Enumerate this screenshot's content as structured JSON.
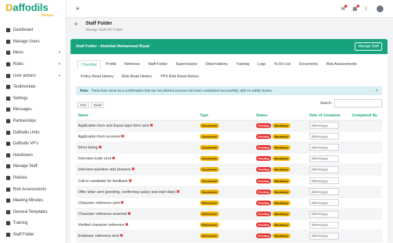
{
  "brand": {
    "name_first": "D",
    "name_rest": "affodils",
    "sub": "Homes"
  },
  "sidebar": {
    "items": [
      {
        "label": "Dashboard",
        "caret": ""
      },
      {
        "label": "Manage Users",
        "caret": ""
      },
      {
        "label": "Menu",
        "caret": "▾"
      },
      {
        "label": "Roles",
        "caret": "▾"
      },
      {
        "label": "User actions",
        "caret": "▾"
      },
      {
        "label": "Testimonials",
        "caret": ""
      },
      {
        "label": "Settings",
        "caret": ""
      },
      {
        "label": "Messages",
        "caret": ""
      },
      {
        "label": "Partnerships",
        "caret": ""
      },
      {
        "label": "Daffodils Units",
        "caret": ""
      },
      {
        "label": "Daffodils VP's",
        "caret": ""
      },
      {
        "label": "Handovers",
        "caret": ""
      },
      {
        "label": "Manage Staff",
        "caret": ""
      },
      {
        "label": "Policies",
        "caret": ""
      },
      {
        "label": "Risk Assessments",
        "caret": ""
      },
      {
        "label": "Meeting Minutes",
        "caret": ""
      },
      {
        "label": "General Templates",
        "caret": ""
      },
      {
        "label": "Training",
        "caret": ""
      },
      {
        "label": "Staff Folder",
        "caret": ""
      }
    ]
  },
  "topbar": {
    "menu_icon": "≡",
    "mail_icon": "✉",
    "grid_icon": "▦",
    "moon_icon": "☾"
  },
  "page": {
    "back": "«",
    "title": "Staff Folder",
    "subtitle": "Manage Staff HR Folder"
  },
  "card": {
    "title": "Staff Folder - Abdullah Mohammad Riyad",
    "manage_button": "Manage Staff",
    "tabs": [
      "Checklist",
      "Profile",
      "Referees",
      "Staff Folder",
      "Supervisions",
      "Observations",
      "Training",
      "Logs",
      "To Do List",
      "Documents",
      "Risk Assessments",
      "Policy Read History",
      "Risk Read History",
      "YPS Risk Read History"
    ],
    "active_tab": 0,
    "alert": {
      "label": "Note:",
      "text": "These lists serve as a confirmation that our recruitment process has been completed successfully, with no safety issues.",
      "close": "×"
    },
    "export_buttons": [
      "CSV",
      "Excel"
    ],
    "search_label": "Search:",
    "search_value": ""
  },
  "table": {
    "headers": [
      "Name",
      "Type",
      "Status",
      "Date of Complete",
      "Completed By"
    ],
    "date_placeholder": "dd/mm/yyyy",
    "rows": [
      {
        "name": "Application form and Equal opps form sent",
        "type": "Documents",
        "status": "Pending",
        "req": "Mandatory"
      },
      {
        "name": "Application form received",
        "type": "Documents",
        "status": "Pending",
        "req": "Mandatory"
      },
      {
        "name": "Short listing",
        "type": "Documents",
        "status": "Pending",
        "req": "Mandatory"
      },
      {
        "name": "Interview invite sent",
        "type": "Documents",
        "status": "Pending",
        "req": "Mandatory"
      },
      {
        "name": "Interview question and answers",
        "type": "Documents",
        "status": "Pending",
        "req": "Mandatory"
      },
      {
        "name": "Call to candidate for feedback",
        "type": "Documents",
        "status": "Pending",
        "req": "Mandatory"
      },
      {
        "name": "Offer letter sent (pending, confirming salary and start date)",
        "type": "Documents",
        "status": "Pending",
        "req": "Mandatory"
      },
      {
        "name": "Character reference sent",
        "type": "References",
        "status": "Pending",
        "req": "Mandatory"
      },
      {
        "name": "Character reference received",
        "type": "References",
        "status": "Pending",
        "req": "Mandatory"
      },
      {
        "name": "Verified character reference",
        "type": "References",
        "status": "Pending",
        "req": "Mandatory"
      },
      {
        "name": "Employer reference sent",
        "type": "References",
        "status": "Pending",
        "req": "Mandatory"
      }
    ]
  },
  "colors": {
    "brand_green": "#16a37e",
    "badge_yellow": "#f2b705",
    "badge_red": "#e53935"
  }
}
